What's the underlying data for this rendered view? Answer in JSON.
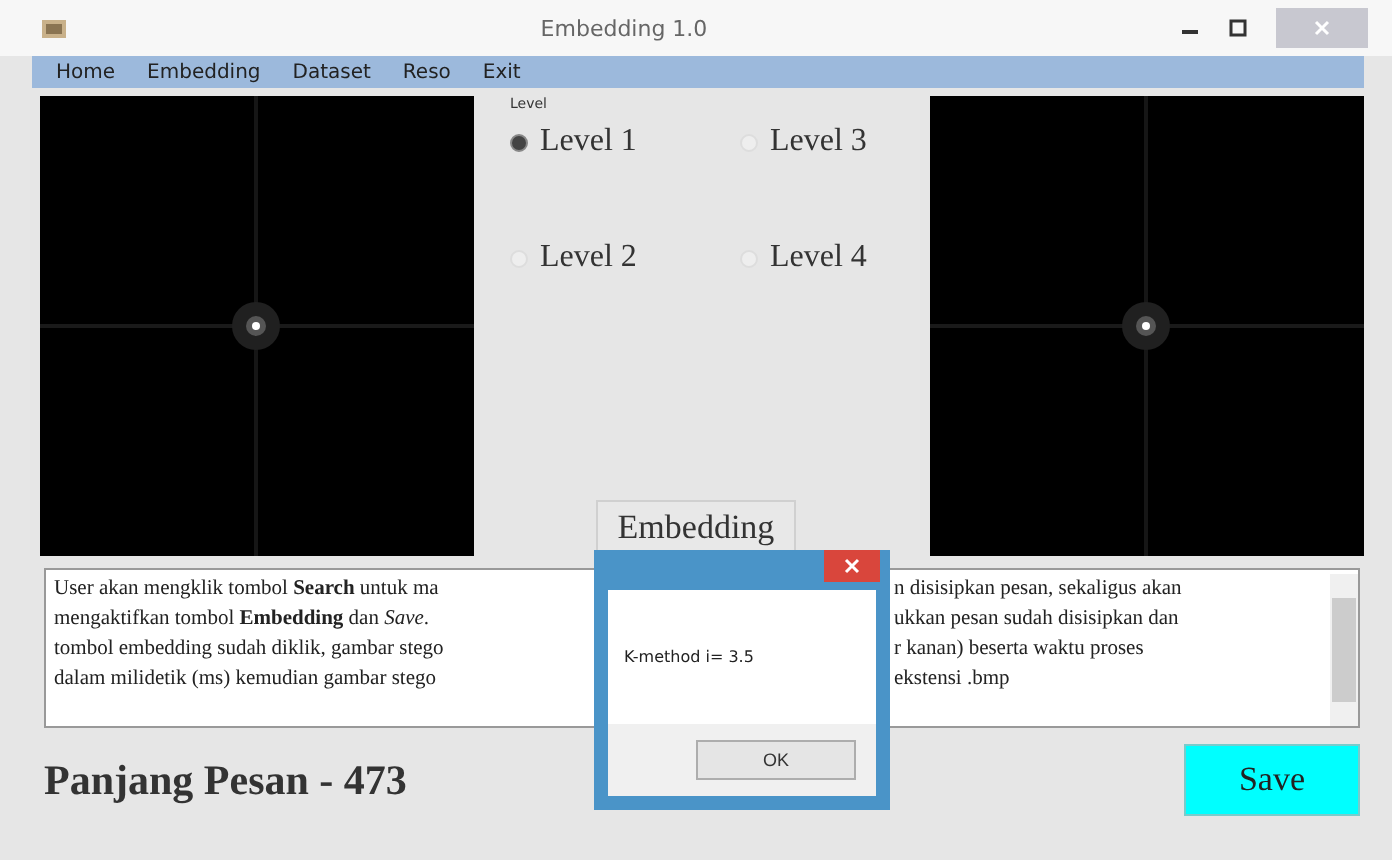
{
  "window": {
    "title": "Embedding 1.0"
  },
  "menu": [
    {
      "label": "Home"
    },
    {
      "label": "Embedding"
    },
    {
      "label": "Dataset"
    },
    {
      "label": "Reso"
    },
    {
      "label": "Exit"
    }
  ],
  "level_group": {
    "label": "Level",
    "options": [
      {
        "label": "Level 1",
        "selected": true
      },
      {
        "label": "Level 3",
        "selected": false
      },
      {
        "label": "Level 2",
        "selected": false
      },
      {
        "label": "Level 4",
        "selected": false
      }
    ]
  },
  "embedding_button": "Embedding",
  "description": {
    "left": [
      "User akan mengklik tombol **Search** untuk ma",
      "mengaktifkan tombol **Embedding** dan *Save*.",
      "tombol embedding sudah diklik, gambar stego",
      "dalam milidetik (ms) kemudian gambar stego"
    ],
    "right": [
      "n disisipkan pesan, sekaligus akan",
      "ukkan pesan sudah disisipkan dan",
      "r kanan) beserta waktu proses",
      "ekstensi .bmp"
    ]
  },
  "message_length": "Panjang Pesan - 473",
  "save_button": "Save",
  "dialog": {
    "message": "K-method i= 3.5",
    "ok_button": "OK"
  }
}
